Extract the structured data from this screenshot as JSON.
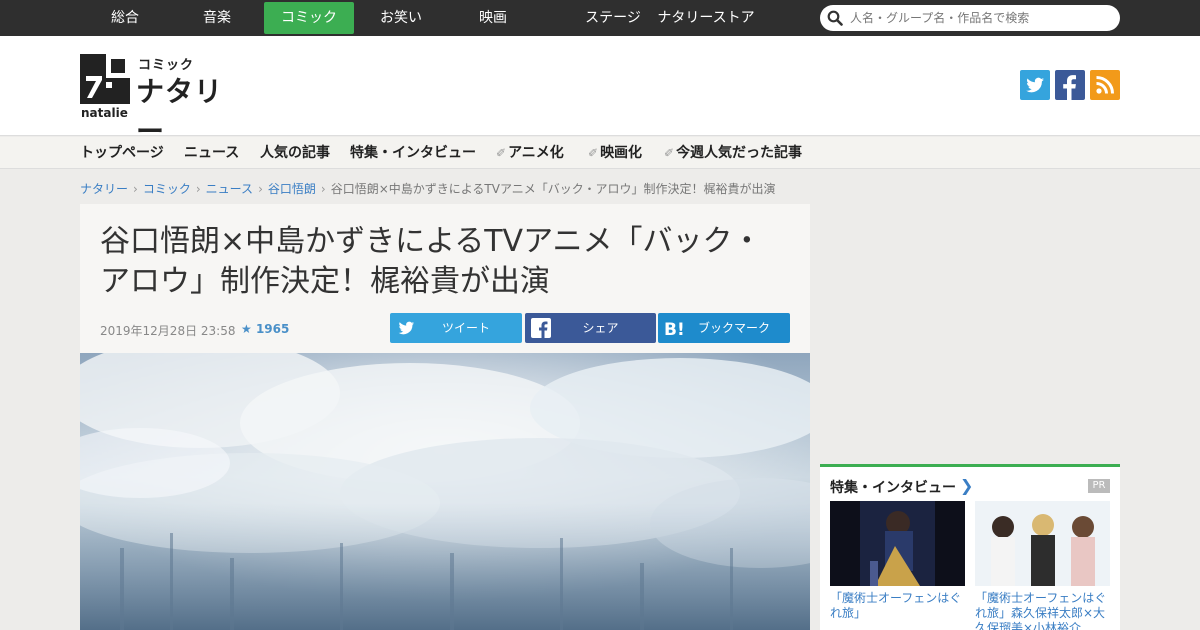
{
  "genre_nav": {
    "items": [
      "総合",
      "音楽",
      "コミック",
      "お笑い",
      "映画",
      "ステージ",
      "ナタリーストア"
    ],
    "active": "コミック",
    "active_color": "#3cae52"
  },
  "search": {
    "placeholder": "人名・グループ名・作品名で検索"
  },
  "logo": {
    "sub": "コミック",
    "main": "ナタリー",
    "en": "natalie"
  },
  "social": [
    {
      "icon": "twitter-icon",
      "color": "#35a4dd"
    },
    {
      "icon": "facebook-icon",
      "color": "#3b5998"
    },
    {
      "icon": "rss-icon",
      "color": "#f29a1a"
    }
  ],
  "category_nav": {
    "items": [
      "トップページ",
      "ニュース",
      "人気の記事",
      "特集・インタビュー",
      "アニメ化",
      "映画化",
      "今週人気だった記事"
    ]
  },
  "breadcrumb": {
    "links": [
      "ナタリー",
      "コミック",
      "ニュース",
      "谷口悟朗"
    ],
    "current": "谷口悟朗×中島かずきによるTVアニメ「バック・アロウ」制作決定！梶裕貴が出演"
  },
  "article": {
    "title": "谷口悟朗×中島かずきによるTVアニメ「バック・アロウ」制作決定！梶裕貴が出演",
    "date": "2019年12月28日 23:58",
    "stars": "1965",
    "share": {
      "tweet": "ツイート",
      "share": "シェア",
      "bookmark": "ブックマーク"
    },
    "colors": {
      "tweet": "#35a4dd",
      "share": "#3b5998",
      "bookmark": "#1e8bcc"
    }
  },
  "feature": {
    "title": "特集・インタビュー",
    "pr": "PR",
    "cards": [
      {
        "caption": "「魔術士オーフェンはぐれ旅」"
      },
      {
        "caption": "「魔術士オーフェンはぐれ旅」森久保祥太郎×大久保瑠美×小林裕介"
      }
    ]
  }
}
